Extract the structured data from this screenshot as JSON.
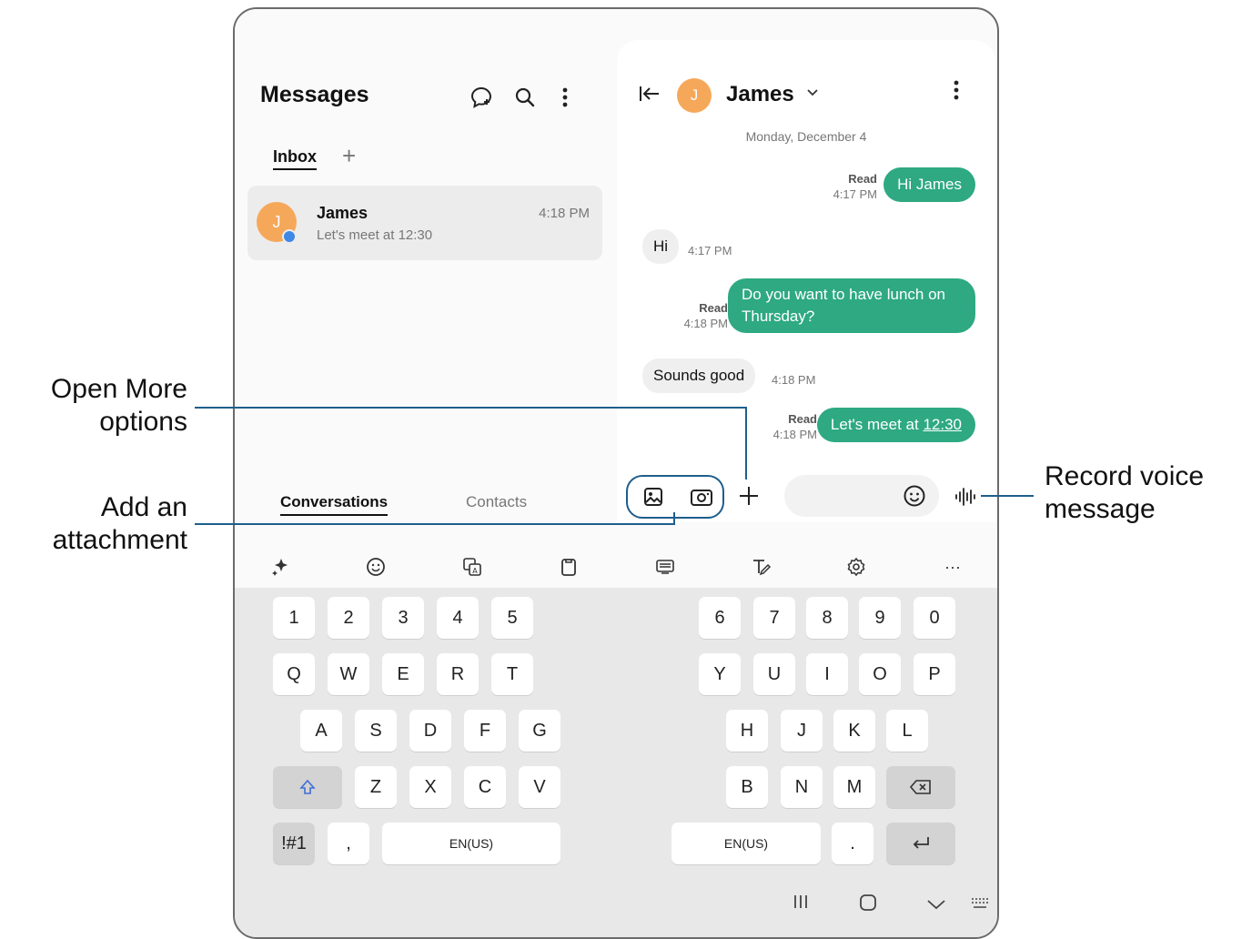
{
  "messages_app": {
    "title": "Messages",
    "tabs": {
      "inbox": "Inbox",
      "add": "+"
    },
    "conversation": {
      "avatar_letter": "J",
      "name": "James",
      "preview": "Let's meet at 12:30",
      "time": "4:18 PM"
    },
    "bottom_tabs": {
      "conversations": "Conversations",
      "contacts": "Contacts"
    }
  },
  "chat": {
    "avatar_letter": "J",
    "contact_name": "James",
    "date": "Monday, December 4",
    "messages": [
      {
        "text": "Hi James",
        "read": "Read",
        "time": "4:17 PM"
      },
      {
        "text": "Hi",
        "time": "4:17 PM"
      },
      {
        "text_line1": "Do you want to have lunch on",
        "text_line2": "Thursday?",
        "read": "Read",
        "time": "4:18 PM"
      },
      {
        "text": "Sounds good",
        "time": "4:18 PM"
      },
      {
        "text_prefix": "Let's meet at ",
        "text_link": "12:30",
        "read": "Read",
        "time": "4:18 PM"
      }
    ]
  },
  "keyboard": {
    "row_numbers_left": [
      "1",
      "2",
      "3",
      "4",
      "5"
    ],
    "row_numbers_right": [
      "6",
      "7",
      "8",
      "9",
      "0"
    ],
    "row_q_left": [
      "Q",
      "W",
      "E",
      "R",
      "T"
    ],
    "row_q_right": [
      "Y",
      "U",
      "I",
      "O",
      "P"
    ],
    "row_a_left": [
      "A",
      "S",
      "D",
      "F",
      "G"
    ],
    "row_a_right": [
      "H",
      "J",
      "K",
      "L"
    ],
    "row_z_left": [
      "Z",
      "X",
      "C",
      "V"
    ],
    "row_z_right": [
      "B",
      "N",
      "M"
    ],
    "symbols": "!#1",
    "comma": ",",
    "space_left": "EN(US)",
    "space_right": "EN(US)",
    "period": ".",
    "toolbar_more": "···"
  },
  "callouts": {
    "open_more_l1": "Open More",
    "open_more_l2": "options",
    "add_attach_l1": "Add an",
    "add_attach_l2": "attachment",
    "record_voice_l1": "Record voice",
    "record_voice_l2": "message"
  },
  "colors": {
    "accent": "#2ea982",
    "callout": "#1f5e8c",
    "avatar": "#f6a85a",
    "unread": "#3f88e6"
  }
}
